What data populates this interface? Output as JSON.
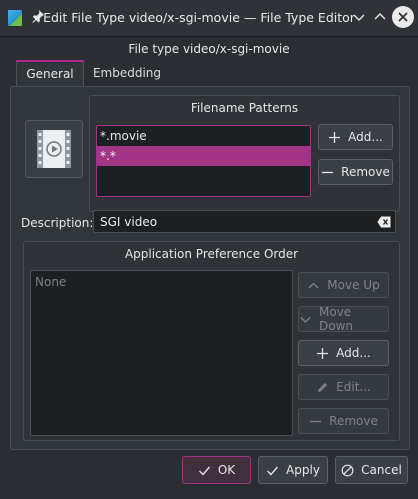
{
  "window": {
    "title": "Edit File Type video/x-sgi-movie — File Type Editor",
    "subtitle": "File type video/x-sgi-movie"
  },
  "tabs": [
    {
      "label": "General",
      "active": true
    },
    {
      "label": "Embedding",
      "active": false
    }
  ],
  "patterns": {
    "group_title": "Filename Patterns",
    "items": [
      "*.movie",
      "*.*"
    ],
    "selected_index": 1,
    "add_label": "Add...",
    "remove_label": "Remove"
  },
  "description": {
    "label": "Description:",
    "value": "SGI video"
  },
  "applications": {
    "group_title": "Application Preference Order",
    "empty_text": "None",
    "move_up_label": "Move Up",
    "move_down_label": "Move Down",
    "add_label": "Add...",
    "edit_label": "Edit...",
    "remove_label": "Remove"
  },
  "footer": {
    "ok_label": "OK",
    "apply_label": "Apply",
    "cancel_label": "Cancel"
  },
  "colors": {
    "accent": "#a23386",
    "background": "#2a2e32",
    "panel": "#31363b"
  }
}
